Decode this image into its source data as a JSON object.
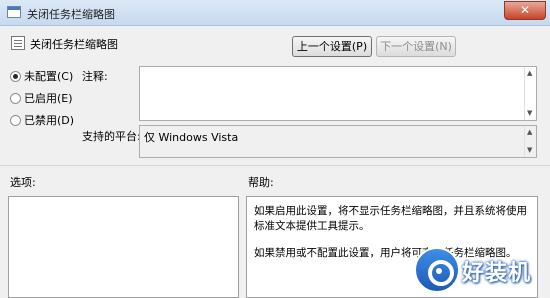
{
  "window": {
    "title": "关闭任务栏缩略图",
    "close_glyph": "✕"
  },
  "header": {
    "policy_name": "关闭任务栏缩略图",
    "prev_button": "上一个设置(P)",
    "next_button": "下一个设置(N)"
  },
  "state": {
    "options": [
      {
        "label": "未配置(C)",
        "checked": true
      },
      {
        "label": "已启用(E)",
        "checked": false
      },
      {
        "label": "已禁用(D)",
        "checked": false
      }
    ]
  },
  "comment": {
    "label": "注释:",
    "value": ""
  },
  "platform": {
    "label": "支持的平台:",
    "value": "仅 Windows Vista"
  },
  "options_panel": {
    "label": "选项:"
  },
  "help_panel": {
    "label": "帮助:",
    "paragraphs": [
      "如果启用此设置，将不显示任务栏缩略图，并且系统将使用标准文本提供工具提示。",
      "如果禁用或不配置此设置，用户将可查看任务栏缩略图。"
    ]
  },
  "watermark": {
    "text": "好装机"
  },
  "icons": {
    "window": "policy-window-icon",
    "policy": "policy-setting-icon",
    "scroll_up": "▲",
    "scroll_down": "▼"
  }
}
